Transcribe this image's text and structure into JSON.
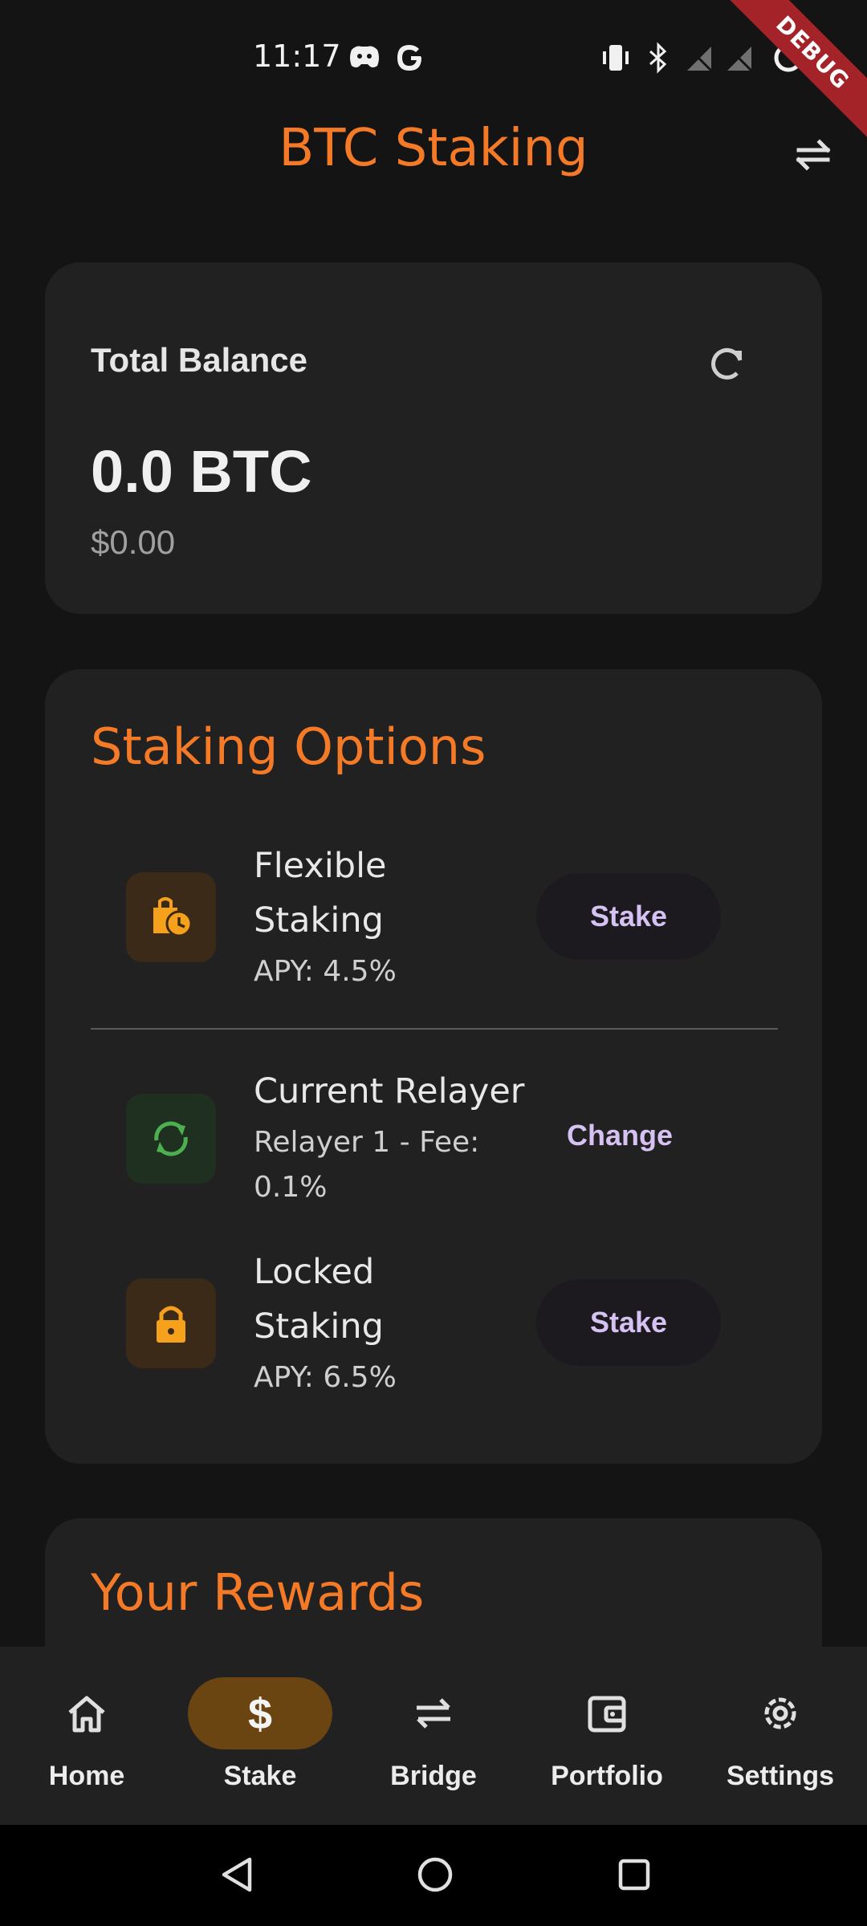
{
  "status_bar": {
    "time": "11:17"
  },
  "debug_banner": "DEBUG",
  "app_bar": {
    "title": "BTC Staking"
  },
  "balance": {
    "label": "Total Balance",
    "amount": "0.0 BTC",
    "usd": "$0.00"
  },
  "staking": {
    "title": "Staking Options",
    "flexible": {
      "title_line1": "Flexible",
      "title_line2": "Staking",
      "apy": "APY: 4.5%",
      "button": "Stake"
    },
    "relayer": {
      "title": "Current Relayer",
      "sub_line1": "Relayer 1 - Fee:",
      "sub_line2": "0.1%",
      "button": "Change"
    },
    "locked": {
      "title_line1": "Locked",
      "title_line2": "Staking",
      "apy": "APY: 6.5%",
      "button": "Stake"
    }
  },
  "rewards": {
    "title": "Your Rewards"
  },
  "nav": {
    "home": "Home",
    "stake": "Stake",
    "bridge": "Bridge",
    "portfolio": "Portfolio",
    "settings": "Settings"
  },
  "colors": {
    "accent": "#f47a28",
    "button_text": "#d6c2f2",
    "active_nav": "#6b4511"
  },
  "icons": {
    "flexible": "clock-bag-icon",
    "relayer": "sync-icon",
    "locked": "lock-icon"
  }
}
